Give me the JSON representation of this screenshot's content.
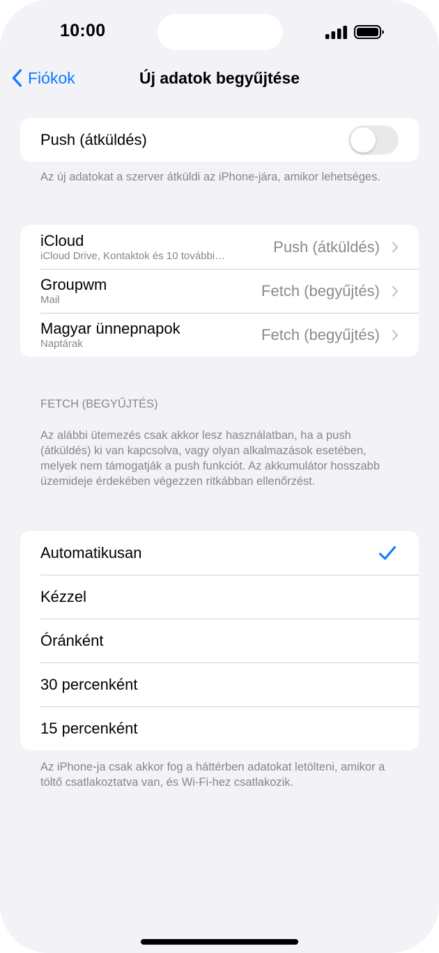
{
  "status_bar": {
    "time": "10:00"
  },
  "nav": {
    "back_label": "Fiókok",
    "title": "Új adatok begyűjtése"
  },
  "push": {
    "label": "Push (átküldés)",
    "enabled": false,
    "note": "Az új adatokat a szerver átküldi az iPhone-jára, amikor lehetséges."
  },
  "accounts": [
    {
      "name": "iCloud",
      "detail": "iCloud Drive, Kontaktok és 10 további…",
      "value": "Push (átküldés)"
    },
    {
      "name": "Groupwm",
      "detail": "Mail",
      "value": "Fetch (begyűjtés)"
    },
    {
      "name": "Magyar ünnepnapok",
      "detail": "Naptárak",
      "value": "Fetch (begyűjtés)"
    }
  ],
  "fetch": {
    "header": "FETCH (BEGYŰJTÉS)",
    "description": "Az alábbi ütemezés csak akkor lesz használatban, ha a push (átküldés) ki van kapcsolva, vagy olyan alkalmazások esetében, melyek nem támogatják a push funkciót. Az akkumulátor hosszabb üzemideje érdekében végezzen ritkábban ellenőrzést.",
    "options": [
      {
        "label": "Automatikusan",
        "selected": true
      },
      {
        "label": "Kézzel",
        "selected": false
      },
      {
        "label": "Óránként",
        "selected": false
      },
      {
        "label": "30 percenként",
        "selected": false
      },
      {
        "label": "15 percenként",
        "selected": false
      }
    ],
    "footer": "Az iPhone-ja csak akkor fog a háttérben adatokat letölteni, amikor a töltő csatlakoztatva van, és Wi-Fi-hez csatlakozik."
  },
  "colors": {
    "accent": "#0a7aff",
    "background": "#f2f2f7",
    "secondary_text": "#86868b",
    "toggle_off": "#e9e9ea"
  },
  "icons": {
    "back": "chevron-left-icon",
    "row": "chevron-right-icon",
    "selected": "checkmark-icon",
    "signal": "cellular-signal-icon",
    "battery": "battery-icon"
  }
}
